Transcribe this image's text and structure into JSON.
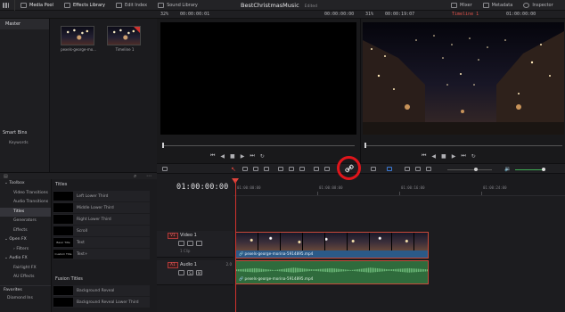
{
  "topbar": {
    "media_pool": "Media Pool",
    "effects_library": "Effects Library",
    "edit_index": "Edit Index",
    "sound_library": "Sound Library",
    "project_name": "BestChristmasMusic",
    "project_state": "Edited",
    "mixer": "Mixer",
    "metadata": "Metadata",
    "inspector": "Inspector"
  },
  "subbar": {
    "zoom_left": "32%",
    "tc_source": "00:00:00:01",
    "tc_source_dur": "00:00:00:00",
    "zoom_right": "31%",
    "tc_program": "00:00:19:07",
    "timeline_name": "Timeline 1",
    "tc_program_pos": "01:00:00:00"
  },
  "bins": {
    "master": "Master",
    "smart_bins": "Smart Bins",
    "keywords": "Keywords"
  },
  "media_pool": {
    "clips": [
      {
        "label": "pexels-george-mo..."
      },
      {
        "label": "Timeline 1"
      }
    ]
  },
  "effects": {
    "tree": [
      {
        "label": "Toolbox",
        "level": "top"
      },
      {
        "label": "Video Transitions",
        "level": "child"
      },
      {
        "label": "Audio Transitions",
        "level": "child"
      },
      {
        "label": "Titles",
        "level": "child",
        "selected": true
      },
      {
        "label": "Generators",
        "level": "child"
      },
      {
        "label": "Effects",
        "level": "child"
      },
      {
        "label": "Open FX",
        "level": "top"
      },
      {
        "label": "Filters",
        "level": "child"
      },
      {
        "label": "Audio FX",
        "level": "top"
      },
      {
        "label": "Fairlight FX",
        "level": "child"
      },
      {
        "label": "AU Effects",
        "level": "child"
      }
    ],
    "favorites": "Favorites",
    "favorite_item": "Diamond Ins",
    "titles_header": "Titles",
    "titles": [
      {
        "name": "Left Lower Third",
        "thumb": ""
      },
      {
        "name": "Middle Lower Third",
        "thumb": ""
      },
      {
        "name": "Right Lower Third",
        "thumb": ""
      },
      {
        "name": "Scroll",
        "thumb": ""
      },
      {
        "name": "Text",
        "thumb": "Basic Title"
      },
      {
        "name": "Text+",
        "thumb": "Custom Title"
      }
    ],
    "fusion_header": "Fusion Titles",
    "fusion_titles": [
      {
        "name": "Background Reveal"
      },
      {
        "name": "Background Reveal Lower Third"
      }
    ]
  },
  "timeline": {
    "timecode": "01:00:00:00",
    "ruler": [
      "01:00:00:00",
      "01:00:08:00",
      "01:00:16:00",
      "01:00:24:00"
    ],
    "video_track": {
      "badge": "V1",
      "name": "Video 1",
      "count": "1 Clip"
    },
    "audio_track": {
      "badge": "A1",
      "name": "Audio 1",
      "level": "2.0",
      "solo": "S",
      "mute": "M"
    },
    "video_clip": "pexels-george-morina-5914895.mp4",
    "audio_clip": "pexels-george-morina-5914895.mp4"
  },
  "colors": {
    "accent_red": "#d0322e",
    "annotation": "#e0151b",
    "video_clip_label": "#2b5a88",
    "audio_clip": "#2f6b3c"
  }
}
